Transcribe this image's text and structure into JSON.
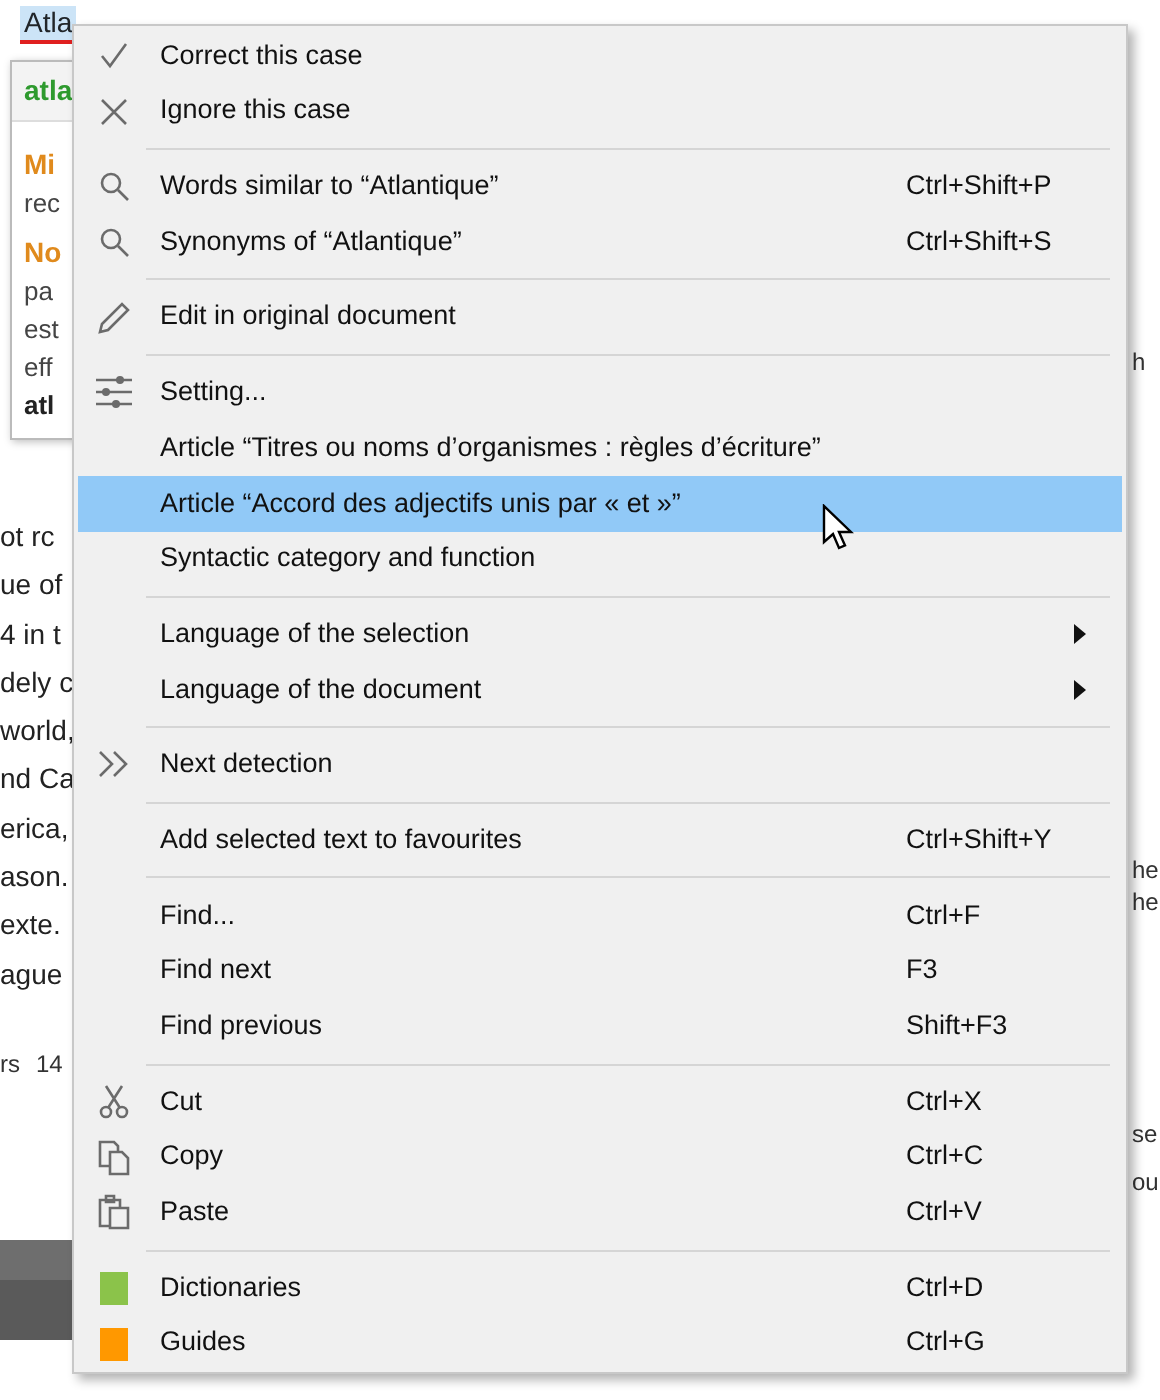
{
  "document": {
    "selected_word": "Atla",
    "lines": [
      "ot rc",
      "ue of",
      "4 in t",
      "dely c",
      "world,",
      "nd Ca",
      "erica,",
      "ason.",
      "exte.",
      "ague"
    ],
    "status_bar": [
      "rs",
      "14"
    ],
    "right_fragments": [
      "h",
      "he",
      "he",
      "se",
      "ou"
    ]
  },
  "popup": {
    "title": "atla",
    "sections": [
      {
        "heading": "Mi",
        "text": [
          "rec"
        ]
      },
      {
        "heading": "No",
        "text": [
          "pa",
          "est",
          "eff"
        ]
      }
    ],
    "footer": "atl"
  },
  "menu": [
    {
      "kind": "item",
      "label": "Correct this case",
      "selected": false
    },
    {
      "kind": "item",
      "label": "Ignore this case",
      "selected": false
    },
    {
      "kind": "separator"
    },
    {
      "kind": "item",
      "label": "Words similar to “Atlantique”",
      "shortcut": "Ctrl+Shift+P",
      "selected": false
    },
    {
      "kind": "item",
      "label": "Synonyms of “Atlantique”",
      "shortcut": "Ctrl+Shift+S",
      "selected": false
    },
    {
      "kind": "separator"
    },
    {
      "kind": "item",
      "label": "Edit in original document",
      "selected": false
    },
    {
      "kind": "separator"
    },
    {
      "kind": "item",
      "label": "Setting...",
      "selected": false
    },
    {
      "kind": "item",
      "label": "Article “Titres ou noms d’organismes : règles d’écriture”",
      "selected": false
    },
    {
      "kind": "item",
      "label": "Article “Accord des adjectifs unis par « et »”",
      "selected": true
    },
    {
      "kind": "item",
      "label": "Syntactic category and function",
      "selected": false
    },
    {
      "kind": "separator"
    },
    {
      "kind": "item",
      "label": "Language of the selection",
      "submenu": true,
      "selected": false
    },
    {
      "kind": "item",
      "label": "Language of the document",
      "submenu": true,
      "selected": false
    },
    {
      "kind": "separator"
    },
    {
      "kind": "item",
      "label": "Next detection",
      "selected": false
    },
    {
      "kind": "separator"
    },
    {
      "kind": "item",
      "label": "Add selected text to favourites",
      "shortcut": "Ctrl+Shift+Y",
      "selected": false
    },
    {
      "kind": "separator"
    },
    {
      "kind": "item",
      "label": "Find...",
      "shortcut": "Ctrl+F",
      "selected": false
    },
    {
      "kind": "item",
      "label": "Find next",
      "shortcut": "F3",
      "selected": false
    },
    {
      "kind": "item",
      "label": "Find previous",
      "shortcut": "Shift+F3",
      "selected": false
    },
    {
      "kind": "separator"
    },
    {
      "kind": "item",
      "label": "Cut",
      "shortcut": "Ctrl+X",
      "selected": false
    },
    {
      "kind": "item",
      "label": "Copy",
      "shortcut": "Ctrl+C",
      "selected": false
    },
    {
      "kind": "item",
      "label": "Paste",
      "shortcut": "Ctrl+V",
      "selected": false
    },
    {
      "kind": "separator"
    },
    {
      "kind": "item",
      "label": "Dictionaries",
      "shortcut": "Ctrl+D",
      "selected": false,
      "color": "#8bc34a"
    },
    {
      "kind": "item",
      "label": "Guides",
      "shortcut": "Ctrl+G",
      "selected": false,
      "color": "#ff9800"
    }
  ]
}
